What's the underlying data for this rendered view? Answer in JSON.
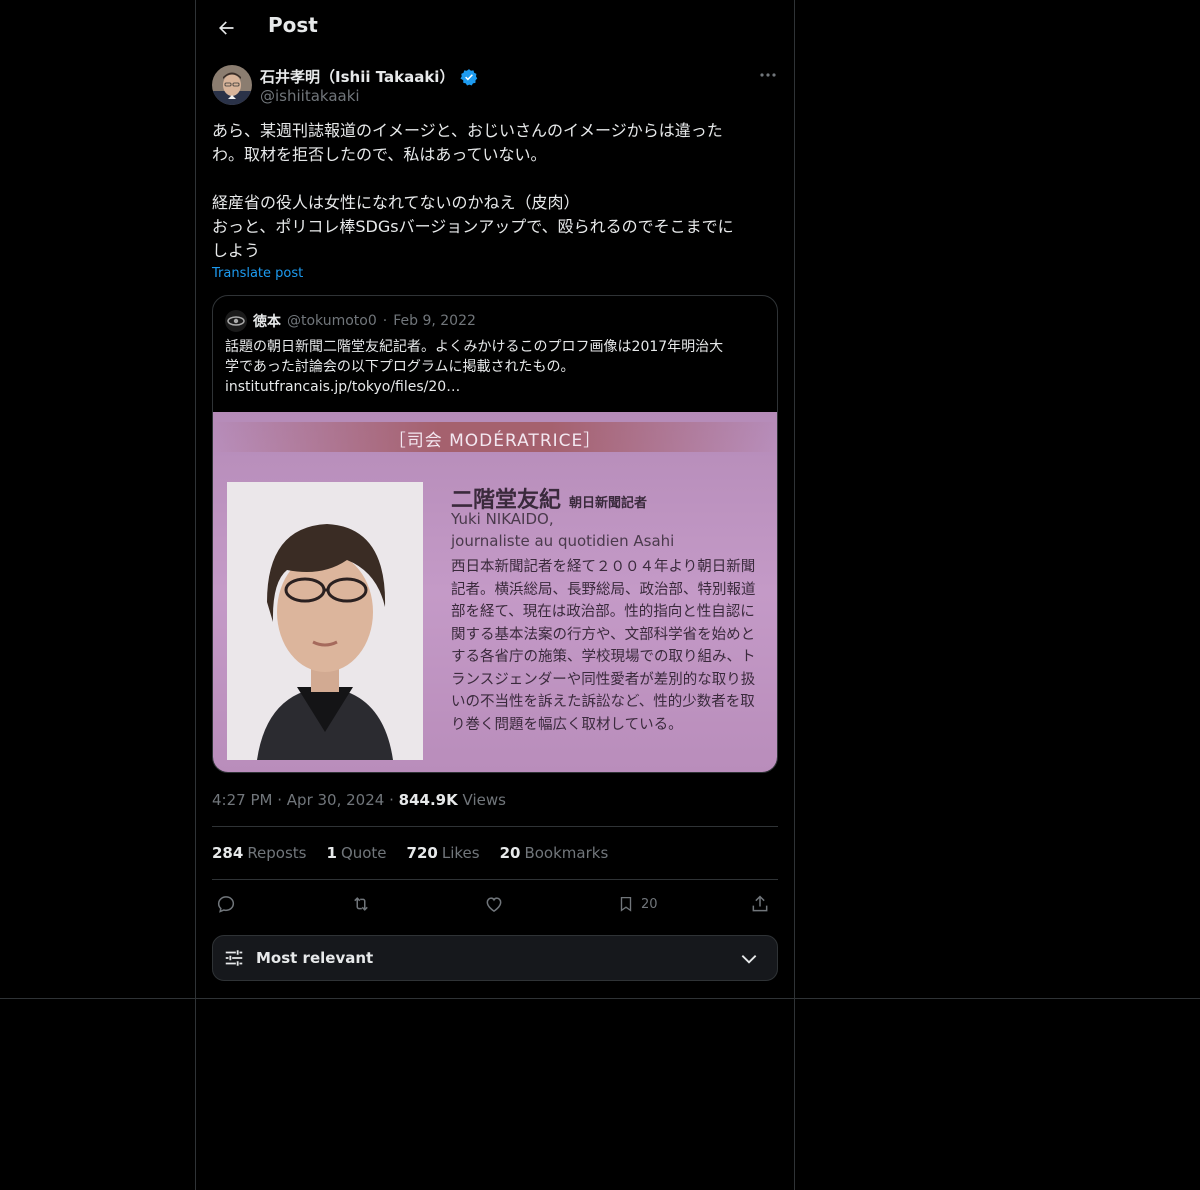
{
  "header": {
    "title": "Post"
  },
  "author": {
    "name": "石井孝明（Ishii Takaaki）",
    "handle": "@ishiitakaaki"
  },
  "post": {
    "text": "あら、某週刊誌報道のイメージと、おじいさんのイメージからは違った\nわ。取材を拒否したので、私はあっていない。\n\n経産省の役人は女性になれてないのかねえ（皮肉）\nおっと、ポリコレ棒SDGsバージョンアップで、殴られるのでそこまでに\nしよう",
    "translate_label": "Translate post"
  },
  "quote": {
    "name": "徳本",
    "handle": "@tokumoto0",
    "dot": "·",
    "date": "Feb 9, 2022",
    "text_line1": "話題の朝日新聞二階堂友紀記者。よくみかけるこのプロフ画像は2017年明治大",
    "text_line2": "学であった討論会の以下プログラムに掲載されたもの。",
    "text_line3": "institutfrancais.jp/tokyo/files/20…",
    "image": {
      "banner": "［司会  MODÉRATRICE］",
      "name": "二階堂友紀",
      "role": "朝日新聞記者",
      "sub1": "Yuki NIKAIDO,",
      "sub2": "journaliste au quotidien Asahi",
      "body": "西日本新聞記者を経て２００４年より朝日新聞記者。横浜総局、長野総局、政治部、特別報道部を経て、現在は政治部。性的指向と性自認に関する基本法案の行方や、文部科学省を始めとする各省庁の施策、学校現場での取り組み、トランスジェンダーや同性愛者が差別的な取り扱いの不当性を訴えた訴訟など、性的少数者を取り巻く問題を幅広く取材している。"
    }
  },
  "meta": {
    "time": "4:27 PM",
    "dot": "·",
    "date": "Apr 30, 2024",
    "views_count": "844.9K",
    "views_label": "Views"
  },
  "stats": [
    {
      "count": "284",
      "label": "Reposts"
    },
    {
      "count": "1",
      "label": "Quote"
    },
    {
      "count": "720",
      "label": "Likes"
    },
    {
      "count": "20",
      "label": "Bookmarks"
    }
  ],
  "actions": {
    "bookmark_count": "20"
  },
  "sort": {
    "label": "Most relevant"
  },
  "colors": {
    "background": "#000000",
    "text": "#e7e9ea",
    "muted": "#71767b",
    "accent": "#1d9bf0",
    "border": "#2f3336"
  },
  "icons": {
    "back": "arrow-left-icon",
    "verified": "verified-badge-icon",
    "more": "more-icon",
    "reply": "reply-icon",
    "repost": "repost-icon",
    "like": "heart-icon",
    "bookmark": "bookmark-icon",
    "share": "share-icon",
    "sort": "sliders-icon",
    "chevron": "chevron-down-icon"
  }
}
